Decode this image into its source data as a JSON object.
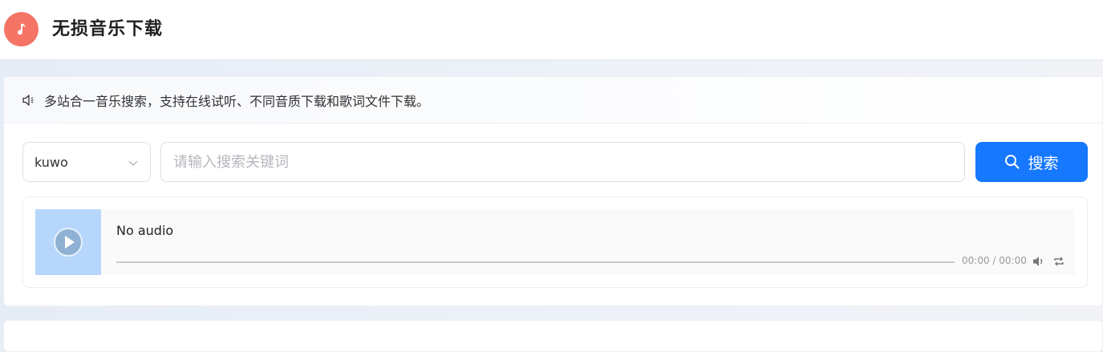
{
  "app": {
    "title": "无损音乐下载",
    "logo_icon": "music-note-icon",
    "logo_color": "#f47466"
  },
  "notice": {
    "icon": "speaker-icon",
    "text": "多站合一音乐搜索，支持在线试听、不同音质下载和歌词文件下载。"
  },
  "search": {
    "source_value": "kuwo",
    "source_icon": "chevron-down-icon",
    "query_value": "",
    "placeholder": "请输入搜索关键词",
    "button_label": "搜索",
    "button_icon": "search-icon",
    "button_color": "#1677ff"
  },
  "player": {
    "title": "No audio",
    "time": "00:00 / 00:00",
    "cover_color": "#b6d7fb",
    "play_icon": "play-icon",
    "volume_icon": "volume-icon",
    "loop_icon": "loop-icon",
    "progress": 0
  }
}
